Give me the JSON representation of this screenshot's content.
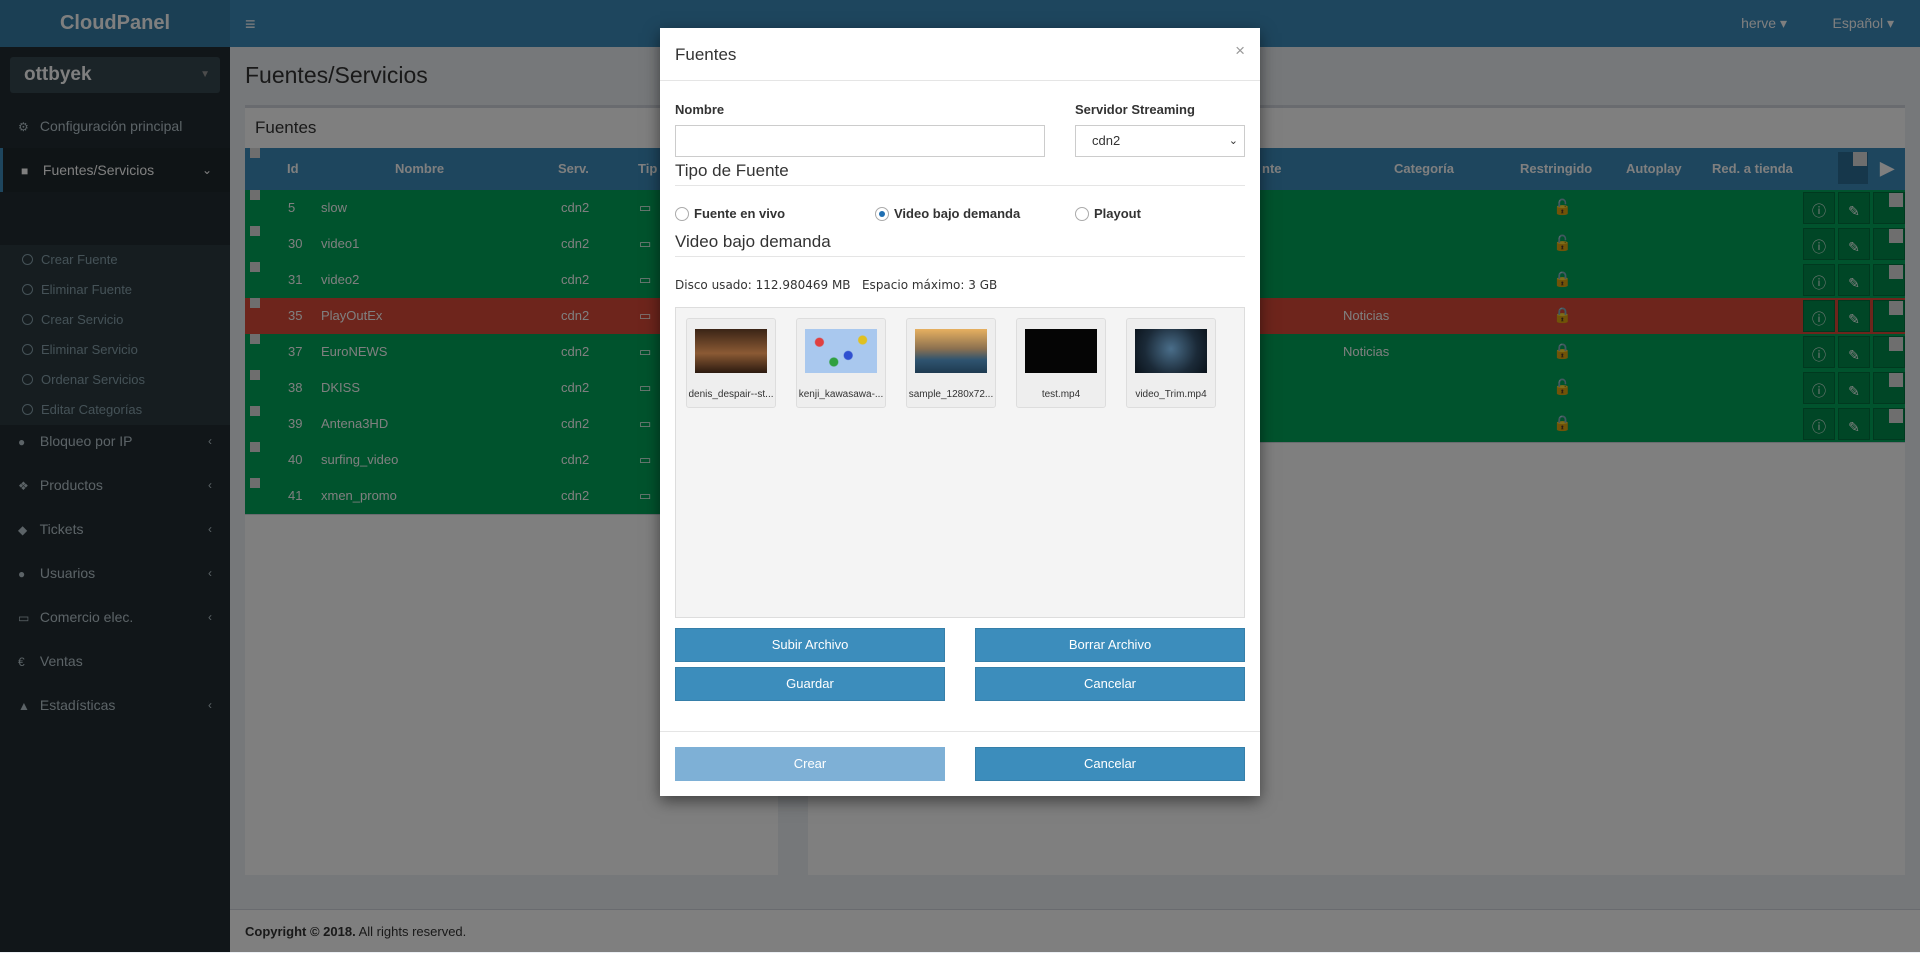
{
  "header": {
    "logo": "CloudPanel",
    "menu_icon": "≡",
    "user": "herve ▾",
    "language": "Español ▾"
  },
  "sidebar": {
    "tenant": "ottbyek",
    "items": [
      {
        "label": "Configuración principal",
        "icon": "gears-icon"
      },
      {
        "label": "Fuentes/Servicios",
        "icon": "video-camera-icon"
      },
      {
        "label": "Bloqueo por IP",
        "icon": "globe-icon"
      },
      {
        "label": "Productos",
        "icon": "cubes-icon"
      },
      {
        "label": "Tickets",
        "icon": "ticket-icon"
      },
      {
        "label": "Usuarios",
        "icon": "user-icon"
      },
      {
        "label": "Comercio elec.",
        "icon": "credit-card-icon"
      },
      {
        "label": "Ventas",
        "icon": "euro-icon"
      },
      {
        "label": "Estadísticas",
        "icon": "area-chart-icon"
      }
    ],
    "subitems": [
      "Crear Fuente",
      "Eliminar Fuente",
      "Crear Servicio",
      "Eliminar Servicio",
      "Ordenar Servicios",
      "Editar Categorías"
    ]
  },
  "page": {
    "title": "Fuentes/Servicios",
    "left_box_title": "Fuentes"
  },
  "left_table": {
    "headers": [
      "Id",
      "Nombre",
      "Serv.",
      "Tip"
    ],
    "rows": [
      {
        "id": "5",
        "name": "slow",
        "serv": "cdn2",
        "color": "#00a65a"
      },
      {
        "id": "30",
        "name": "video1",
        "serv": "cdn2",
        "color": "#00a65a"
      },
      {
        "id": "31",
        "name": "video2",
        "serv": "cdn2",
        "color": "#00a65a"
      },
      {
        "id": "35",
        "name": "PlayOutEx",
        "serv": "cdn2",
        "color": "#dd4b39"
      },
      {
        "id": "37",
        "name": "EuroNEWS",
        "serv": "cdn2",
        "color": "#00a65a"
      },
      {
        "id": "38",
        "name": "DKISS",
        "serv": "cdn2",
        "color": "#00a65a"
      },
      {
        "id": "39",
        "name": "Antena3HD",
        "serv": "cdn2",
        "color": "#00a65a"
      },
      {
        "id": "40",
        "name": "surfing_video",
        "serv": "cdn2",
        "color": "#00a65a"
      },
      {
        "id": "41",
        "name": "xmen_promo",
        "serv": "cdn2",
        "color": "#00a65a"
      }
    ]
  },
  "right_table": {
    "headers": [
      "nte",
      "Categoría",
      "Restringido",
      "Autoplay",
      "Red. a tienda"
    ],
    "rows": [
      {
        "categoria": "",
        "lock": "unlocked"
      },
      {
        "categoria": "",
        "lock": "unlocked"
      },
      {
        "categoria": "",
        "lock": "locked"
      },
      {
        "categoria": "Noticias",
        "lock": "locked"
      },
      {
        "categoria": "Noticias",
        "lock": "locked"
      },
      {
        "categoria": "",
        "lock": "unlocked"
      },
      {
        "categoria": "",
        "lock": "locked"
      }
    ]
  },
  "footer": {
    "copyright": "Copyright © 2018.",
    "rights": "All rights reserved."
  },
  "modal": {
    "title": "Fuentes",
    "close": "×",
    "name_label": "Nombre",
    "name_value": "",
    "server_label": "Servidor Streaming",
    "server_value": "cdn2",
    "source_type_title": "Tipo de Fuente",
    "radio_live": "Fuente en vivo",
    "radio_vod": "Video bajo demanda",
    "radio_playout": "Playout",
    "vod_title": "Video bajo demanda",
    "disk_info": "Disco usado: 112.980469 MB   Espacio máximo: 3 GB",
    "files": [
      {
        "name": "denis_despair--st...",
        "thumb": "#5a3a2a"
      },
      {
        "name": "kenji_kawasawa-...",
        "thumb": "#a9c8ee"
      },
      {
        "name": "sample_1280x72...",
        "thumb": "#7a6a50"
      },
      {
        "name": "test.mp4",
        "thumb": "#050505"
      },
      {
        "name": "video_Trim.mp4",
        "thumb": "#1b2a38"
      }
    ],
    "btn_upload": "Subir Archivo",
    "btn_delete": "Borrar Archivo",
    "btn_save": "Guardar",
    "btn_cancel_inner": "Cancelar",
    "btn_create": "Crear",
    "btn_cancel": "Cancelar"
  }
}
